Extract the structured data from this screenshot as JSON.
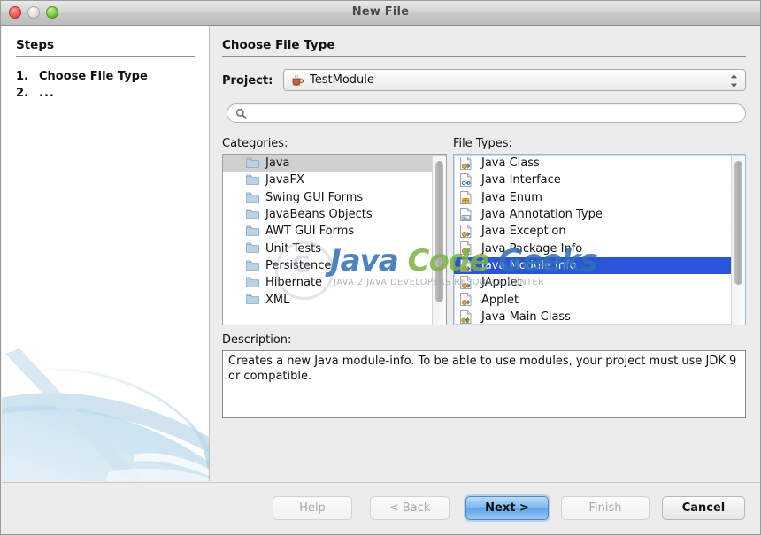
{
  "window": {
    "title": "New File",
    "controls": {
      "close": "close-button",
      "minimize": "minimize-button",
      "zoom": "zoom-button"
    }
  },
  "sidebar": {
    "heading": "Steps",
    "steps": [
      {
        "number": "1.",
        "label": "Choose File Type"
      },
      {
        "number": "2.",
        "label": "..."
      }
    ]
  },
  "main": {
    "heading": "Choose File Type",
    "project": {
      "label": "Project:",
      "value": "TestModule",
      "icon": "java-coffee-cup-icon"
    },
    "search": {
      "placeholder": "",
      "value": "",
      "icon": "search-icon"
    },
    "categories": {
      "label": "Categories:",
      "items": [
        {
          "label": "Java",
          "selected": true
        },
        {
          "label": "JavaFX",
          "selected": false
        },
        {
          "label": "Swing GUI Forms",
          "selected": false
        },
        {
          "label": "JavaBeans Objects",
          "selected": false
        },
        {
          "label": "AWT GUI Forms",
          "selected": false
        },
        {
          "label": "Unit Tests",
          "selected": false
        },
        {
          "label": "Persistence",
          "selected": false
        },
        {
          "label": "Hibernate",
          "selected": false
        },
        {
          "label": "XML",
          "selected": false
        }
      ]
    },
    "file_types": {
      "label": "File Types:",
      "items": [
        {
          "label": "Java Class",
          "selected": false
        },
        {
          "label": "Java Interface",
          "selected": false
        },
        {
          "label": "Java Enum",
          "selected": false
        },
        {
          "label": "Java Annotation Type",
          "selected": false
        },
        {
          "label": "Java Exception",
          "selected": false
        },
        {
          "label": "Java Package Info",
          "selected": false
        },
        {
          "label": "Java Module Info",
          "selected": true
        },
        {
          "label": "JApplet",
          "selected": false
        },
        {
          "label": "Applet",
          "selected": false
        },
        {
          "label": "Java Main Class",
          "selected": false
        }
      ]
    },
    "description": {
      "label": "Description:",
      "text": "Creates a new Java module-info. To be able to use modules, your project must use JDK 9 or compatible."
    }
  },
  "footer": {
    "buttons": [
      {
        "id": "help",
        "label": "Help",
        "state": "disabled"
      },
      {
        "id": "back",
        "label": "< Back",
        "state": "disabled"
      },
      {
        "id": "next",
        "label": "Next >",
        "state": "default"
      },
      {
        "id": "finish",
        "label": "Finish",
        "state": "disabled"
      },
      {
        "id": "cancel",
        "label": "Cancel",
        "state": "normal"
      }
    ]
  },
  "watermark": {
    "word1": "Java",
    "word2": "Code",
    "word3": "Geeks",
    "tagline": "JAVA 2 JAVA DEVELOPERS RESOURCE CENTER"
  },
  "colors": {
    "selection_blue": "#2a55d8",
    "selection_gray": "#d0d0d0",
    "panel_gray": "#ececec",
    "default_button_blue": "#5ea3e8"
  }
}
